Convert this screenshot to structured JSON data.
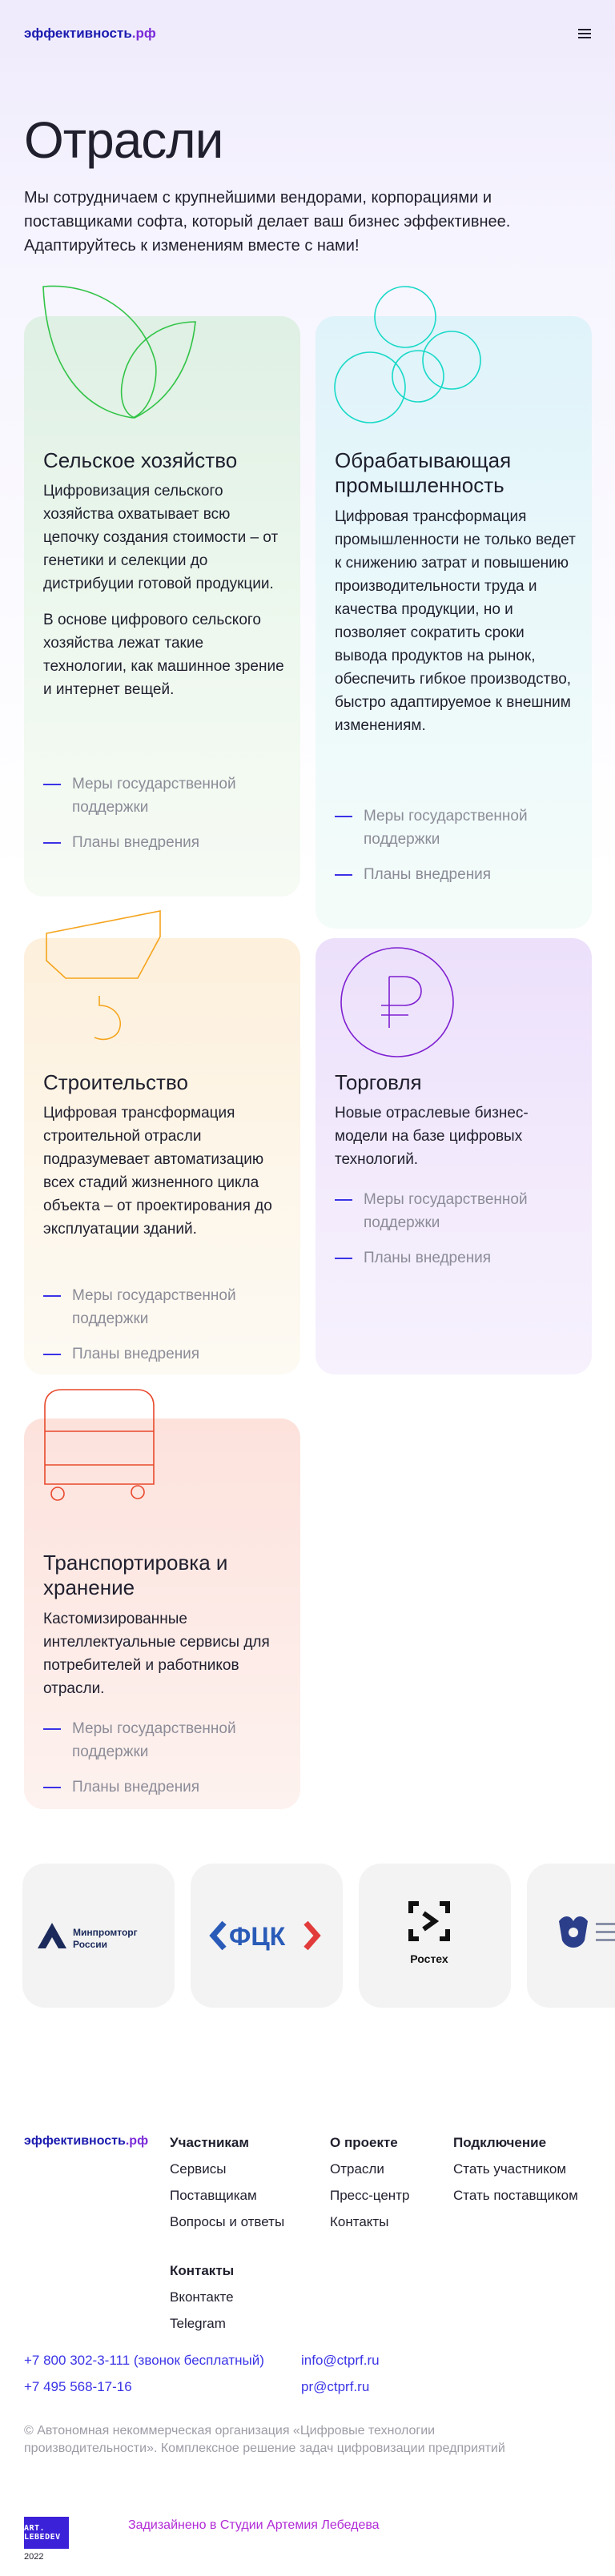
{
  "header": {
    "logo_part1": "эффективность",
    "logo_part2": ".рф",
    "menu_icon": "hamburger-icon"
  },
  "page_title": "Отрасли",
  "intro": "Мы сотрудничаем с крупнейшими вендорами, корпорациями и поставщиками софта, который делает ваш бизнес эффективнее. Адаптируйтесь к изменениям вместе с нами!",
  "industries": [
    {
      "title": "Сельское хозяйство",
      "paragraphs": [
        "Цифровизация сельского хозяйства охватывает всю цепочку создания стоимости – от генетики и селекции до дистрибуции готовой продукции.",
        "В основе цифрового сельского хозяйства лежат такие технологии, как машинное зрение и интернет вещей."
      ],
      "link_support": "Меры государственной поддержки",
      "link_plans": "Планы внедрения",
      "icon": "leaves-icon",
      "color": "#32c447"
    },
    {
      "title": "Обрабатывающая промышленность",
      "paragraphs": [
        "Цифровая трансформация промышленности не только ведет к снижению затрат и повышению производительности труда и качества продукции, но и позволяет сократить сроки вывода продуктов на рынок, обеспечить гибкое производство, быстро адаптируемое к внешним изменениям."
      ],
      "link_support": "Меры государственной поддержки",
      "link_plans": "Планы внедрения",
      "icon": "circles-icon",
      "color": "#17d9c7"
    },
    {
      "title": "Строительство",
      "paragraphs": [
        "Цифровая трансформация строительной отрасли подразумевает автоматизацию всех стадий жизненного цикла объекта – от проектирования до эксплуатации зданий."
      ],
      "link_support": "Меры государственной поддержки",
      "link_plans": "Планы внедрения",
      "icon": "crane-hook-icon",
      "color": "#f5a41c"
    },
    {
      "title": "Торговля",
      "paragraphs": [
        "Новые отраслевые бизнес-модели на базе цифровых технологий."
      ],
      "link_support": "Меры государственной поддержки",
      "link_plans": "Планы внедрения",
      "icon": "ruble-coin-icon",
      "color": "#7e1fd1"
    },
    {
      "title": "Транспортировка и хранение",
      "paragraphs": [
        "Кастомизированные интеллектуальные сервисы для потребителей и работников отрасли."
      ],
      "link_support": "Меры государственной поддержки",
      "link_plans": "Планы внедрения",
      "icon": "bus-icon",
      "color": "#e8492c"
    }
  ],
  "partners": [
    {
      "name": "Минпромторг России",
      "icon": "minpromtorg-logo-icon"
    },
    {
      "name": "ФЦК",
      "icon": "fck-logo-icon"
    },
    {
      "name": "Ростех",
      "icon": "rostec-logo-icon"
    },
    {
      "name": "Министерство цифрового развития, связи и массовых коммуникаций Российской Федерации",
      "icon": "coat-of-arms-icon"
    }
  ],
  "footer": {
    "logo_part1": "эффективность",
    "logo_part2": ".рф",
    "col_participants": {
      "heading": "Участникам",
      "links": [
        "Сервисы",
        "Поставщикам",
        "Вопросы и ответы"
      ]
    },
    "col_project": {
      "heading": "О проекте",
      "links": [
        "Отрасли",
        "Пресс-центр",
        "Контакты"
      ]
    },
    "col_connect": {
      "heading": "Подключение",
      "links": [
        "Стать участником",
        "Стать поставщиком"
      ]
    },
    "col_contacts": {
      "heading": "Контакты",
      "links": [
        "Вконтакте",
        "Telegram"
      ]
    },
    "phone1": "+7 800 302-3-111 (звонок бесплатный)",
    "phone2": "+7 495 568-17-16",
    "email1": "info@ctprf.ru",
    "email2": "pr@ctprf.ru",
    "copyright": "© Автономная некоммерческая организация «Цифровые технологии производительности». Комплексное решение задач цифровизации предприятий",
    "studio_logo": "ART. LEBEDEV",
    "studio_text": "Задизайнено в Студии Артемия Лебедева",
    "year": "2022"
  }
}
